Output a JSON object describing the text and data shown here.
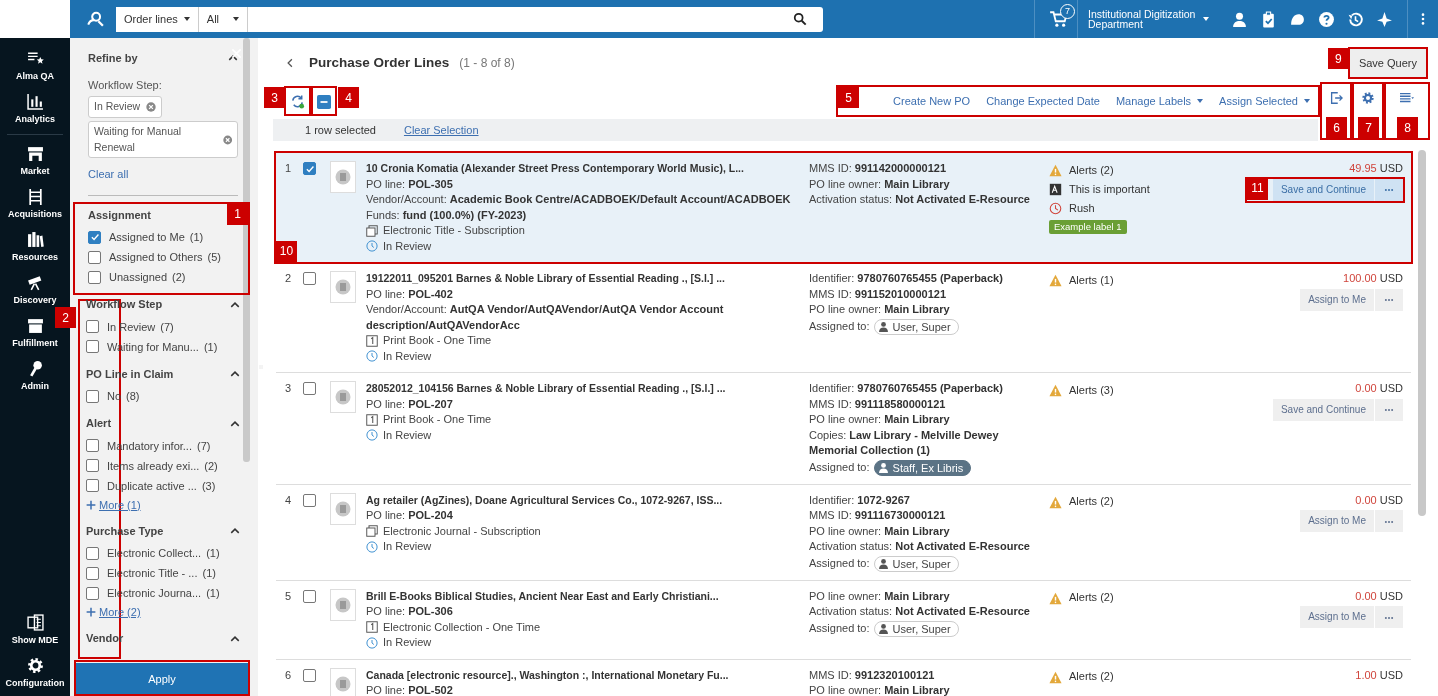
{
  "topbar": {
    "scope": "Order lines",
    "filter": "All",
    "cart_count": "7",
    "institution": "Institutional Digitization Department"
  },
  "nav": {
    "items": [
      {
        "kind": "qa",
        "label": "Alma QA"
      },
      {
        "kind": "analytics",
        "label": "Analytics"
      },
      {
        "kind": "market",
        "label": "Market"
      },
      {
        "kind": "acquisitions",
        "label": "Acquisitions"
      },
      {
        "kind": "resources",
        "label": "Resources"
      },
      {
        "kind": "discovery",
        "label": "Discovery"
      },
      {
        "kind": "fulfillment",
        "label": "Fulfillment"
      },
      {
        "kind": "admin",
        "label": "Admin"
      }
    ],
    "bottom": [
      {
        "kind": "mde",
        "label": "Show MDE"
      },
      {
        "kind": "config",
        "label": "Configuration"
      }
    ]
  },
  "refine": {
    "title": "Refine by",
    "label": "Workflow Step:",
    "chips": [
      "In Review",
      "Waiting for Manual Renewal"
    ],
    "clear": "Clear all"
  },
  "facets": [
    {
      "title": "Assignment",
      "collapsible": false,
      "callout": "1",
      "options": [
        {
          "label": "Assigned to Me",
          "count": "(1)",
          "checked": true
        },
        {
          "label": "Assigned to Others",
          "count": "(5)",
          "checked": false
        },
        {
          "label": "Unassigned",
          "count": "(2)",
          "checked": false
        }
      ]
    },
    {
      "title": "Workflow Step",
      "collapsible": true,
      "options": [
        {
          "label": "In Review",
          "count": "(7)",
          "checked": false
        },
        {
          "label": "Waiting for Manu...",
          "count": "(1)",
          "checked": false
        }
      ]
    },
    {
      "title": "PO Line in Claim",
      "collapsible": true,
      "options": [
        {
          "label": "No",
          "count": "(8)",
          "checked": false
        }
      ]
    },
    {
      "title": "Alert",
      "collapsible": true,
      "options": [
        {
          "label": "Mandatory infor...",
          "count": "(7)",
          "checked": false
        },
        {
          "label": "Items already exi...",
          "count": "(2)",
          "checked": false
        },
        {
          "label": "Duplicate active ...",
          "count": "(3)",
          "checked": false
        }
      ],
      "more": "More (1)"
    },
    {
      "title": "Purchase Type",
      "collapsible": true,
      "options": [
        {
          "label": "Electronic Collect...",
          "count": "(1)",
          "checked": false
        },
        {
          "label": "Electronic Title - ...",
          "count": "(1)",
          "checked": false
        },
        {
          "label": "Electronic Journa...",
          "count": "(1)",
          "checked": false
        }
      ],
      "more": "More (2)"
    },
    {
      "title": "Vendor",
      "collapsible": true
    }
  ],
  "facets_callout": "2",
  "apply": {
    "label": "Apply"
  },
  "header": {
    "title": "Purchase Order Lines",
    "count": "(1 - 8 of 8)",
    "save": "Save Query",
    "save_callout": "9"
  },
  "toolbar": {
    "refresh_callout": "3",
    "select_all_partial": true,
    "select_all_callout": "4",
    "actions": [
      {
        "label": "Create New PO",
        "dropdown": false
      },
      {
        "label": "Change Expected Date",
        "dropdown": false
      },
      {
        "label": "Manage Labels",
        "dropdown": true
      },
      {
        "label": "Assign Selected",
        "dropdown": true
      }
    ],
    "actions_callout": "5",
    "tools": [
      {
        "kind": "export",
        "callout": "6"
      },
      {
        "kind": "settings",
        "callout": "7"
      },
      {
        "kind": "view",
        "callout": "8"
      }
    ]
  },
  "selection": {
    "text": "1 row selected",
    "clear": "Clear Selection"
  },
  "rows": [
    {
      "number": "1",
      "selected": true,
      "callout": "10",
      "title": "10 Cronia Komatia (Alexander Street Press Contemporary World Music), L...",
      "fields": [
        {
          "label": "PO line:",
          "value": "POL-305"
        },
        {
          "label": "Vendor/Account:",
          "value": "Academic Book Centre/ACADBOEK/Default Account/ACADBOEK"
        },
        {
          "label": "Funds:",
          "value": "fund (100.0%) (FY-2023)"
        }
      ],
      "format": {
        "kind": "electronic",
        "text": "Electronic Title - Subscription"
      },
      "status": "In Review",
      "info": [
        {
          "kind": "field",
          "label": "MMS ID:",
          "value": "991142000000121"
        },
        {
          "kind": "field",
          "label": "PO line owner:",
          "value": "Main Library"
        },
        {
          "kind": "field",
          "label": "Activation status:",
          "value": "Not Activated E-Resource"
        }
      ],
      "alerts": [
        {
          "kind": "warning",
          "text": "Alerts (2)"
        },
        {
          "kind": "note",
          "text": "This is important"
        },
        {
          "kind": "rush",
          "text": "Rush"
        }
      ],
      "labels": [
        "Example label 1"
      ],
      "amount": "49.95",
      "currency": "USD",
      "action": "Save and Continue",
      "action_callout": "11"
    },
    {
      "number": "2",
      "selected": false,
      "title": "19122011_095201 Barnes & Noble Library of Essential Reading ., [S.l.] ...",
      "fields": [
        {
          "label": "PO line:",
          "value": "POL-402"
        },
        {
          "label": "Vendor/Account:",
          "value": "AutQA Vendor/AutQAVendor/AutQA Vendor Account description/AutQAVendorAcc"
        }
      ],
      "format": {
        "kind": "print",
        "text": "Print Book - One Time"
      },
      "status": "In Review",
      "info": [
        {
          "kind": "field",
          "label": "Identifier:",
          "value": "9780760765455 (Paperback)"
        },
        {
          "kind": "field",
          "label": "MMS ID:",
          "value": "991152010000121"
        },
        {
          "kind": "field",
          "label": "PO line owner:",
          "value": "Main Library"
        },
        {
          "kind": "assignee",
          "label": "Assigned to:",
          "value": "User, Super",
          "emphasized": false
        }
      ],
      "alerts": [
        {
          "kind": "warning",
          "text": "Alerts (1)"
        }
      ],
      "amount": "100.00",
      "currency": "USD",
      "action": "Assign to Me"
    },
    {
      "number": "3",
      "selected": false,
      "title": "28052012_104156 Barnes & Noble Library of Essential Reading ., [S.l.] ...",
      "fields": [
        {
          "label": "PO line:",
          "value": "POL-207"
        }
      ],
      "format": {
        "kind": "print",
        "text": "Print Book - One Time"
      },
      "status": "In Review",
      "info": [
        {
          "kind": "field",
          "label": "Identifier:",
          "value": "9780760765455 (Paperback)"
        },
        {
          "kind": "field",
          "label": "MMS ID:",
          "value": "991118580000121"
        },
        {
          "kind": "field",
          "label": "PO line owner:",
          "value": "Main Library"
        },
        {
          "kind": "field",
          "label": "Copies:",
          "value": "Law Library - Melville Dewey Memorial Collection (1)"
        },
        {
          "kind": "assignee",
          "label": "Assigned to:",
          "value": "Staff, Ex Libris",
          "emphasized": true
        }
      ],
      "alerts": [
        {
          "kind": "warning",
          "text": "Alerts (3)"
        }
      ],
      "amount": "0.00",
      "currency": "USD",
      "action": "Save and Continue"
    },
    {
      "number": "4",
      "selected": false,
      "title": "Ag retailer (AgZines), Doane Agricultural Services Co., 1072-9267, ISS...",
      "fields": [
        {
          "label": "PO line:",
          "value": "POL-204"
        }
      ],
      "format": {
        "kind": "electronic",
        "text": "Electronic Journal - Subscription"
      },
      "status": "In Review",
      "info": [
        {
          "kind": "field",
          "label": "Identifier:",
          "value": "1072-9267"
        },
        {
          "kind": "field",
          "label": "MMS ID:",
          "value": "991116730000121"
        },
        {
          "kind": "field",
          "label": "PO line owner:",
          "value": "Main Library"
        },
        {
          "kind": "field",
          "label": "Activation status:",
          "value": "Not Activated E-Resource"
        },
        {
          "kind": "assignee",
          "label": "Assigned to:",
          "value": "User, Super",
          "emphasized": false
        }
      ],
      "alerts": [
        {
          "kind": "warning",
          "text": "Alerts (2)"
        }
      ],
      "amount": "0.00",
      "currency": "USD",
      "action": "Assign to Me"
    },
    {
      "number": "5",
      "selected": false,
      "title": "Brill E-Books Biblical Studies, Ancient Near East and Early Christiani...",
      "fields": [
        {
          "label": "PO line:",
          "value": "POL-306"
        }
      ],
      "format": {
        "kind": "print",
        "text": "Electronic Collection - One Time"
      },
      "status": "In Review",
      "info": [
        {
          "kind": "field",
          "label": "PO line owner:",
          "value": "Main Library"
        },
        {
          "kind": "field",
          "label": "Activation status:",
          "value": "Not Activated E-Resource"
        },
        {
          "kind": "assignee",
          "label": "Assigned to:",
          "value": "User, Super",
          "emphasized": false
        }
      ],
      "alerts": [
        {
          "kind": "warning",
          "text": "Alerts (2)"
        }
      ],
      "amount": "0.00",
      "currency": "USD",
      "action": "Assign to Me"
    },
    {
      "number": "6",
      "selected": false,
      "title": "Canada [electronic resource]., Washington :, International Monetary Fu...",
      "fields": [
        {
          "label": "PO line:",
          "value": "POL-502"
        }
      ],
      "info": [
        {
          "kind": "field",
          "label": "MMS ID:",
          "value": "9912320100121"
        },
        {
          "kind": "field",
          "label": "PO line owner:",
          "value": "Main Library"
        }
      ],
      "alerts": [
        {
          "kind": "warning",
          "text": "Alerts (2)"
        }
      ],
      "amount": "1.00",
      "currency": "USD"
    }
  ]
}
